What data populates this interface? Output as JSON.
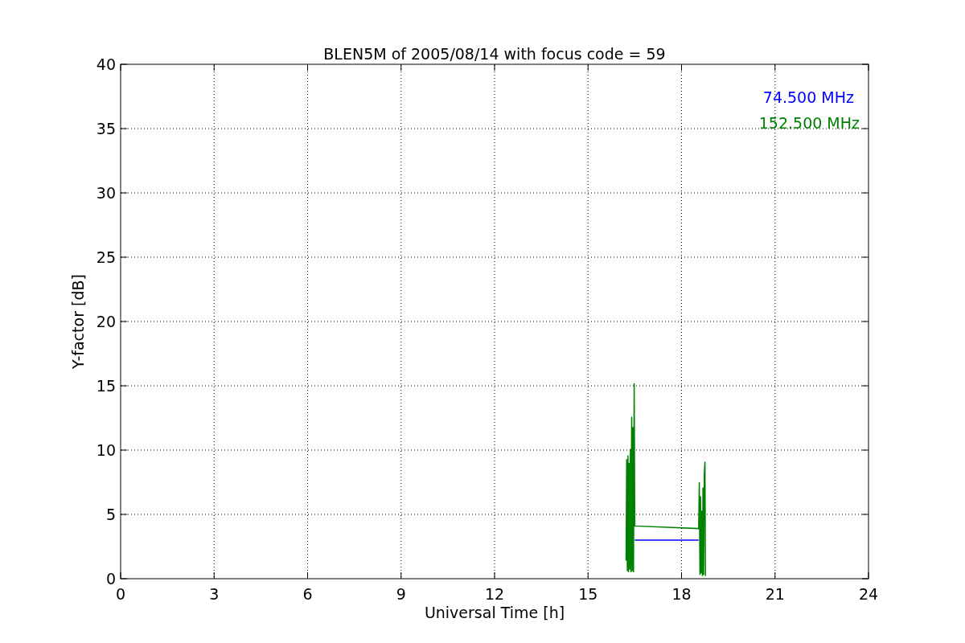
{
  "figure": {
    "chart_data": {
      "type": "line",
      "title": "BLEN5M of 2005/08/14 with focus code = 59",
      "xlabel": "Universal Time [h]",
      "ylabel": "Y-factor [dB]",
      "x": [
        16.22,
        16.24,
        16.26,
        16.28,
        16.3,
        16.32,
        16.34,
        16.36,
        16.38,
        16.4,
        16.42,
        16.44,
        16.46,
        16.48,
        16.5,
        18.55,
        18.57,
        18.59,
        18.61,
        18.63,
        18.65,
        18.67,
        18.69,
        18.71,
        18.73,
        18.75,
        18.77
      ],
      "series": [
        {
          "name": "74.500 MHz",
          "color": "#0000ff",
          "values": [
            null,
            null,
            null,
            null,
            null,
            null,
            null,
            null,
            null,
            null,
            null,
            null,
            null,
            null,
            3.0,
            3.0,
            null,
            null,
            null,
            null,
            null,
            null,
            null,
            null,
            null,
            null,
            null
          ]
        },
        {
          "name": "152.500 MHz",
          "color": "#008000",
          "values": [
            1.4,
            9.3,
            0.6,
            9.6,
            0.5,
            9.0,
            0.7,
            10.1,
            0.5,
            12.6,
            0.6,
            11.8,
            0.5,
            15.2,
            4.1,
            3.9,
            7.5,
            0.3,
            6.4,
            0.4,
            5.3,
            0.2,
            7.1,
            0.3,
            8.1,
            9.1,
            0.2
          ]
        }
      ],
      "xlim": [
        0,
        24
      ],
      "ylim": [
        0,
        40
      ],
      "xticks": [
        0,
        3,
        6,
        9,
        12,
        15,
        18,
        21,
        24
      ],
      "yticks": [
        0,
        5,
        10,
        15,
        20,
        25,
        30,
        35,
        40
      ],
      "grid": true
    }
  }
}
